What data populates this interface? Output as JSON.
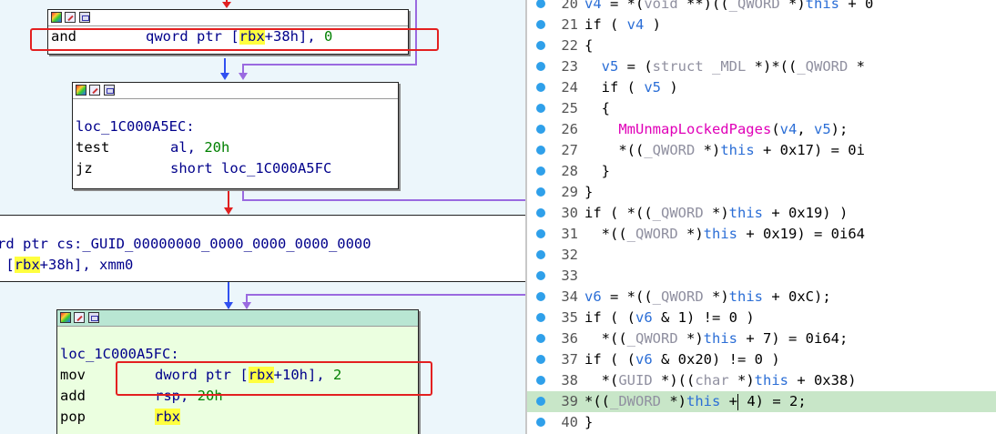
{
  "graph": {
    "node1": {
      "line": {
        "mnem": "and",
        "ops": [
          "qword ptr [",
          "rbx",
          "+38h], ",
          "0"
        ]
      }
    },
    "node2": {
      "label": "loc_1C000A5EC:",
      "lines": [
        {
          "mnem": "test",
          "ops": "al, ",
          "num": "20h"
        },
        {
          "mnem": "jz",
          "ops": "short loc_1C000A5FC"
        }
      ]
    },
    "frag1": "rd ptr cs:_GUID_00000000_0000_0000_0000_0000",
    "frag2": {
      "pre": " [",
      "reg": "rbx",
      "post": "+38h], xmm0"
    },
    "node3": {
      "label": "loc_1C000A5FC:",
      "lines": [
        {
          "mnem": "mov",
          "ops": "dword ptr [",
          "reg": "rbx",
          "mid": "+10h], ",
          "num": "2"
        },
        {
          "mnem": "add",
          "ops": "rsp, ",
          "num": "20h"
        },
        {
          "mnem": "pop",
          "reg": "rbx"
        }
      ]
    }
  },
  "code": {
    "lines": [
      {
        "n": "20",
        "text": "v4 = *(void **)((_QWORD *)this + 0"
      },
      {
        "n": "21",
        "text": "if ( v4 )"
      },
      {
        "n": "22",
        "text": "{"
      },
      {
        "n": "23",
        "text": "  v5 = (struct _MDL *)*((_QWORD *"
      },
      {
        "n": "24",
        "text": "  if ( v5 )"
      },
      {
        "n": "25",
        "text": "  {"
      },
      {
        "n": "26",
        "text": "    MmUnmapLockedPages(v4, v5);"
      },
      {
        "n": "27",
        "text": "    *((_QWORD *)this + 0x17) = 0i"
      },
      {
        "n": "28",
        "text": "  }"
      },
      {
        "n": "29",
        "text": "}"
      },
      {
        "n": "30",
        "text": "if ( *((_QWORD *)this + 0x19) )"
      },
      {
        "n": "31",
        "text": "  *((_QWORD *)this + 0x19) = 0i64"
      },
      {
        "n": "32",
        "text": ""
      },
      {
        "n": "33",
        "text": ""
      },
      {
        "n": "34",
        "text": "v6 = *((_QWORD *)this + 0xC);"
      },
      {
        "n": "35",
        "text": "if ( (v6 & 1) != 0 )"
      },
      {
        "n": "36",
        "text": "  *((_QWORD *)this + 7) = 0i64;"
      },
      {
        "n": "37",
        "text": "if ( (v6 & 0x20) != 0 )"
      },
      {
        "n": "38",
        "text": "  *(GUID *)((char *)this + 0x38)"
      },
      {
        "n": "39",
        "text": "*((_DWORD *)this + 4) = 2;"
      },
      {
        "n": "40",
        "text": "}"
      }
    ]
  }
}
